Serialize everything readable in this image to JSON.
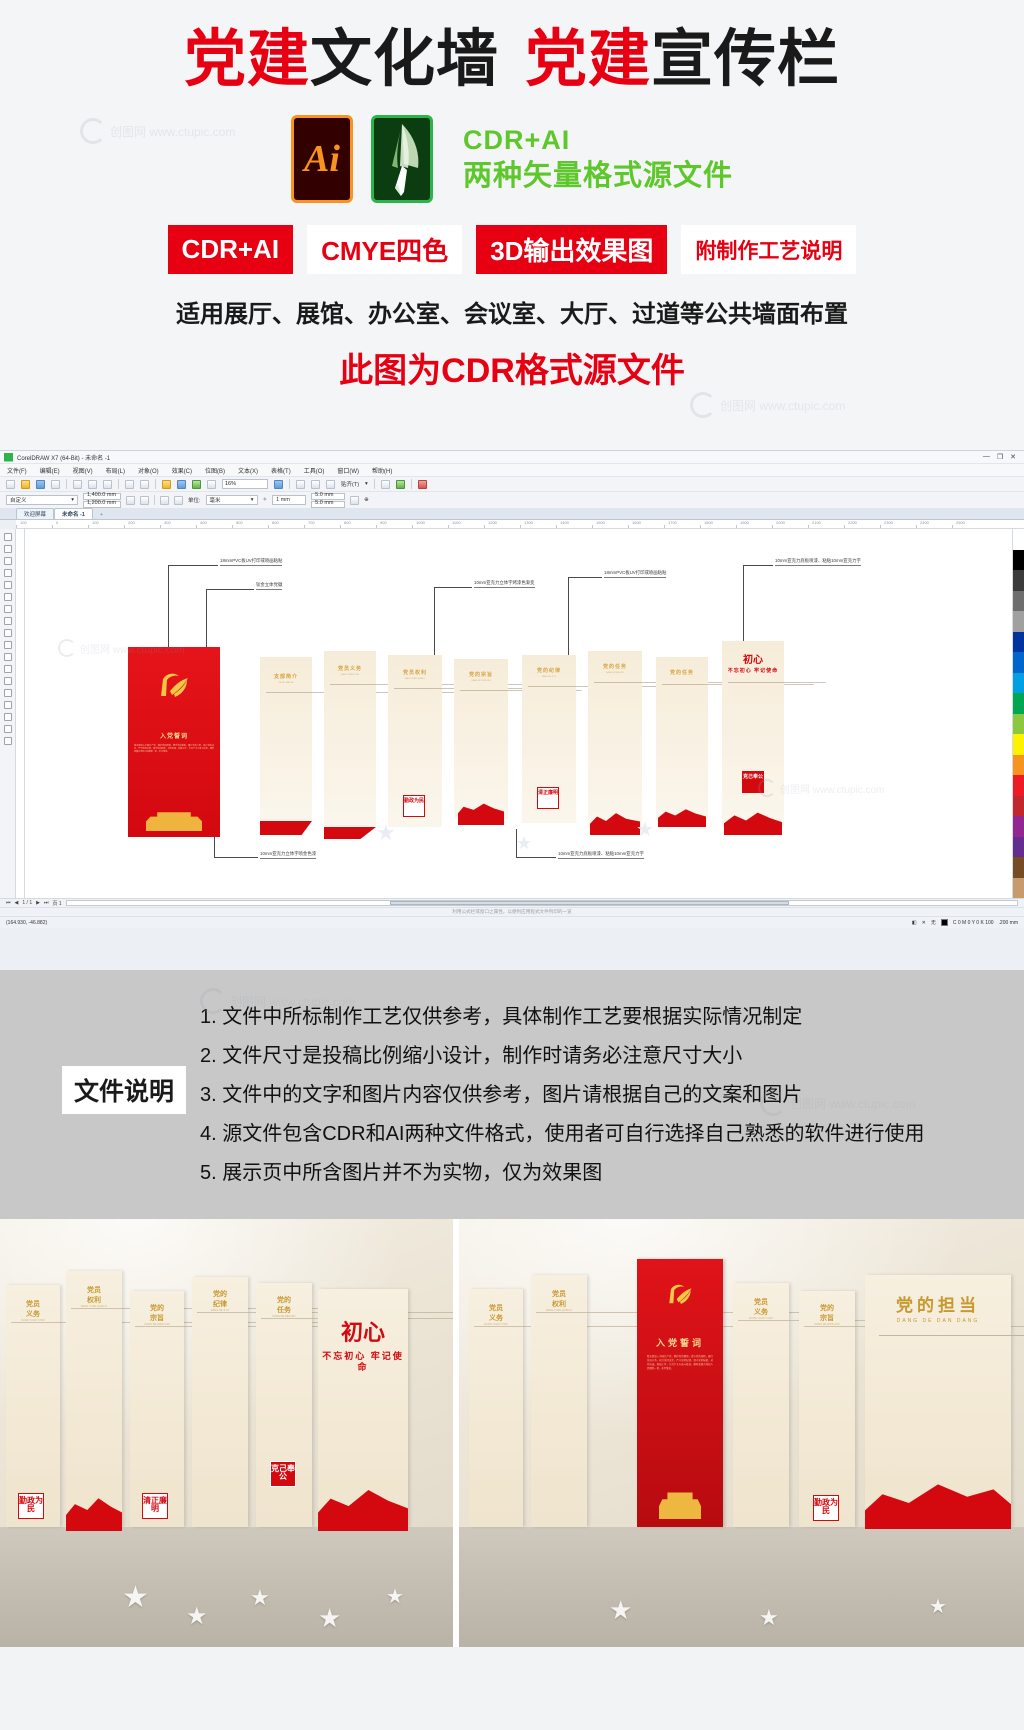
{
  "promo": {
    "title_parts": [
      {
        "text": "党建",
        "color": "#e60012"
      },
      {
        "text": "文化墙",
        "color": "#1a1a1a"
      },
      {
        "text": "党建",
        "color": "#e60012"
      },
      {
        "text": "宣传栏",
        "color": "#1a1a1a"
      }
    ],
    "ai_badge_label": "Ai",
    "cdr_badge_label": "CorelDRAW",
    "format_line1": "CDR+AI",
    "format_line2": "两种矢量格式源文件",
    "tags": [
      {
        "label": "CDR+AI",
        "style": "filled"
      },
      {
        "label": "CMYE四色",
        "style": "outline"
      },
      {
        "label": "3D输出效果图",
        "style": "filled"
      },
      {
        "label": "附制作工艺说明",
        "style": "outline"
      }
    ],
    "apply_line": "适用展厅、展馆、办公室、会议室、大厅、过道等公共墙面布置",
    "cdr_line": "此图为CDR格式源文件",
    "watermark": "创图网 www.ctupic.com"
  },
  "coreldraw": {
    "title": "CorelDRAW X7 (64-Bit) - 未命名 -1",
    "window_buttons": [
      "—",
      "❐",
      "✕"
    ],
    "menus": [
      "文件(F)",
      "编辑(E)",
      "视图(V)",
      "布局(L)",
      "对象(O)",
      "效果(C)",
      "位图(B)",
      "文本(X)",
      "表格(T)",
      "工具(O)",
      "窗口(W)",
      "帮助(H)"
    ],
    "toolbar": {
      "zoom_level": "16%",
      "snap_label": "贴齐(T)",
      "arrow": "▾"
    },
    "propbar": {
      "preset": "自定义",
      "page_width": "1,400.0 mm",
      "page_height": "1,200.0 mm",
      "units_label": "单位:",
      "units_value": "毫米",
      "nudge": "1 mm",
      "duplicate_x": "5.0 mm",
      "duplicate_y": "5.0 mm"
    },
    "tabs": [
      {
        "label": "欢迎屏幕",
        "active": false
      },
      {
        "label": "未命名 -1",
        "active": true
      },
      {
        "label": "+",
        "active": false
      }
    ],
    "ruler_ticks": [
      "100",
      "0",
      "100",
      "200",
      "300",
      "400",
      "500",
      "600",
      "700",
      "800",
      "900",
      "1000",
      "1100",
      "1200",
      "1300",
      "1400",
      "1500",
      "1600",
      "1700",
      "1800",
      "1900",
      "2000",
      "2100",
      "2200",
      "2300",
      "2400",
      "2500"
    ],
    "callouts": [
      {
        "text": "18mmPVC板UV打印或喷画粘贴"
      },
      {
        "text": "钛金立体党徽"
      },
      {
        "text": "10mm亚克力立体字烤漆色渐变"
      },
      {
        "text": "18mmPVC板UV打印或喷画粘贴"
      },
      {
        "text": "10mm亚克力底板喷漆、粘贴10mm亚克力字"
      },
      {
        "text": "10mm亚克力立体字喷金色漆"
      },
      {
        "text": "10mm亚克力底板喷漆、粘贴10mm亚克力字"
      }
    ],
    "design_panels": [
      {
        "title": "入党誓词",
        "subtitle": "",
        "kind": "red-oath"
      },
      {
        "title": "支部简介",
        "pinyin": "ZHI BU JIAN JIE",
        "kind": "cream"
      },
      {
        "title": "党员义务",
        "pinyin": "DANG YUAN YI WU",
        "kind": "cream"
      },
      {
        "title": "党员权利",
        "pinyin": "DANG YUAN QUAN LI",
        "kind": "cream",
        "stamp": "勤政为民"
      },
      {
        "title": "党的宗旨",
        "pinyin": "DANG DE ZONG ZHI",
        "kind": "cream",
        "stamp": "清正廉明"
      },
      {
        "title": "党的纪律",
        "pinyin": "DANG DE JI LU",
        "kind": "cream"
      },
      {
        "title": "党的任务",
        "pinyin": "DANG DE REN WU",
        "kind": "cream"
      },
      {
        "title": "不忘初心 牢记使命",
        "kind": "cream-final",
        "stamp": "克己奉公"
      }
    ],
    "oath_text": "我志愿加入中国共产党，拥护党的纲领，遵守党的章程，履行党员义务，执行党的决定，严守党的纪律，保守党的秘密，对党忠诚，积极工作，为共产主义奋斗终身，随时准备为党和人民牺牲一切，永不叛党。",
    "statusbar": {
      "page_nav": "1 / 1",
      "page_label": "页 1",
      "hint": "利用公式栏或窗口之属性，以便利应用程式文件列印的一览",
      "coords": "(164.930, -46.882)",
      "fill_label": "无",
      "outline_color": "C 0 M 0 Y 0 K 100",
      "outline_width": ".200 mm"
    }
  },
  "file_notes": {
    "label": "文件说明",
    "items": [
      "1. 文件中所标制作工艺仅供参考，具体制作工艺要根据实际情况制定",
      "2. 文件尺寸是投稿比例缩小设计，制作时请务必注意尺寸大小",
      "3. 文件中的文字和图片内容仅供参考，图片请根据自己的文案和图片",
      "4. 源文件包含CDR和AI两种文件格式，使用者可自行选择自己熟悉的软件进行使用",
      "5. 展示页中所含图片并不为实物，仅为效果图"
    ]
  },
  "mockups": {
    "left": {
      "panels": [
        {
          "title": "党员\n义务",
          "pinyin": "DANG YUAN YI WU",
          "kind": "cream"
        },
        {
          "title": "党员\n权利",
          "pinyin": "DANG YUAN QUAN LI",
          "kind": "cream"
        },
        {
          "title": "党的\n宗旨",
          "pinyin": "DANG DE ZONG ZHI",
          "kind": "cream"
        },
        {
          "title": "党的\n纪律",
          "pinyin": "DANG DE JI LU",
          "kind": "cream"
        },
        {
          "title": "党的\n任务",
          "pinyin": "DANG DE REN WU",
          "kind": "cream"
        }
      ],
      "stamps": [
        "勤政为民",
        "清正廉明",
        "克己奉公"
      ],
      "headline": "不忘初心 牢记使命"
    },
    "right": {
      "panels": [
        {
          "title": "党员\n义务",
          "pinyin": "DANG YUAN YI WU",
          "kind": "cream"
        },
        {
          "title": "党员\n权利",
          "pinyin": "DANG YUAN QUAN LI",
          "kind": "cream"
        },
        {
          "title": "入党誓词",
          "kind": "red"
        },
        {
          "title": "党员\n义务",
          "pinyin": "DANG YUAN YI WU",
          "kind": "cream"
        },
        {
          "title": "党的\n宗旨",
          "pinyin": "DANG DE ZONG ZHI",
          "kind": "cream"
        }
      ],
      "headline": "党的担当",
      "headline_pinyin": "DANG DE DAN DANG",
      "stamps": [
        "勤政为民"
      ]
    }
  }
}
